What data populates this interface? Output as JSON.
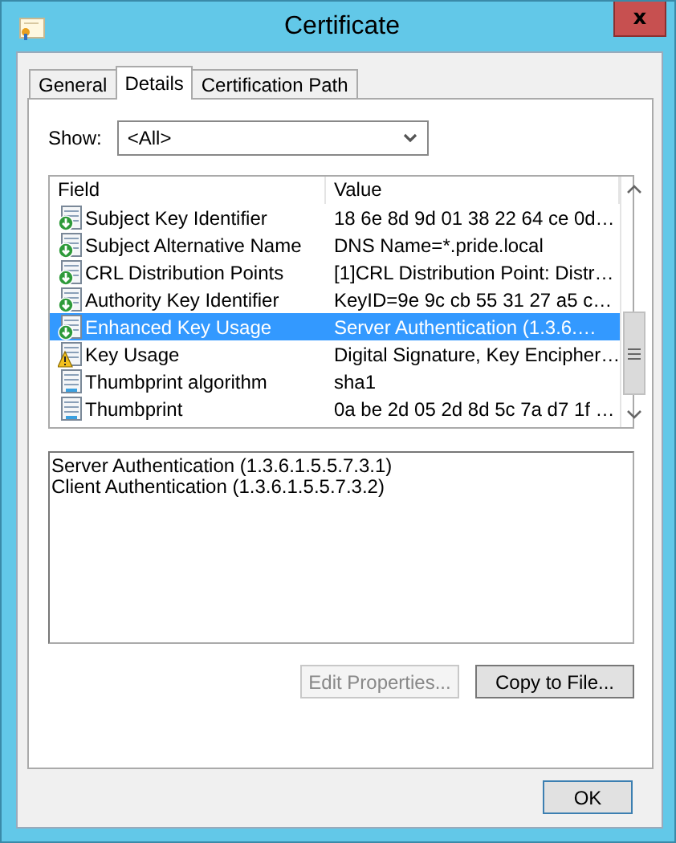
{
  "window": {
    "title": "Certificate",
    "close": "x"
  },
  "tabs": [
    {
      "label": "General",
      "selected": false
    },
    {
      "label": "Details",
      "selected": true
    },
    {
      "label": "Certification Path",
      "selected": false
    }
  ],
  "show": {
    "label": "Show:",
    "value": "<All>"
  },
  "fields": {
    "columns": [
      "Field",
      "Value"
    ],
    "rows": [
      {
        "field": "Subject Key Identifier",
        "value": "18 6e 8d 9d 01 38 22 64 ce 0d…",
        "kind": "extension",
        "selected": false
      },
      {
        "field": "Subject Alternative Name",
        "value": "DNS Name=*.pride.local",
        "kind": "extension",
        "selected": false
      },
      {
        "field": "CRL Distribution Points",
        "value": "[1]CRL Distribution Point: Distr…",
        "kind": "extension",
        "selected": false
      },
      {
        "field": "Authority Key Identifier",
        "value": "KeyID=9e 9c cb 55 31 27 a5 c…",
        "kind": "extension",
        "selected": false
      },
      {
        "field": "Enhanced Key Usage",
        "value": "Server Authentication (1.3.6.…",
        "kind": "extension",
        "selected": true
      },
      {
        "field": "Key Usage",
        "value": "Digital Signature, Key Encipher…",
        "kind": "critical",
        "selected": false
      },
      {
        "field": "Thumbprint algorithm",
        "value": "sha1",
        "kind": "property",
        "selected": false
      },
      {
        "field": "Thumbprint",
        "value": "0a be 2d 05 2d 8d 5c 7a d7 1f …",
        "kind": "property",
        "selected": false
      }
    ]
  },
  "details": [
    "Server Authentication (1.3.6.1.5.5.7.3.1)",
    "Client Authentication (1.3.6.1.5.5.7.3.2)"
  ],
  "buttons": [
    {
      "label": "Edit Properties...",
      "disabled": true
    },
    {
      "label": "Copy to File...",
      "disabled": false
    }
  ],
  "ok_button": "OK"
}
